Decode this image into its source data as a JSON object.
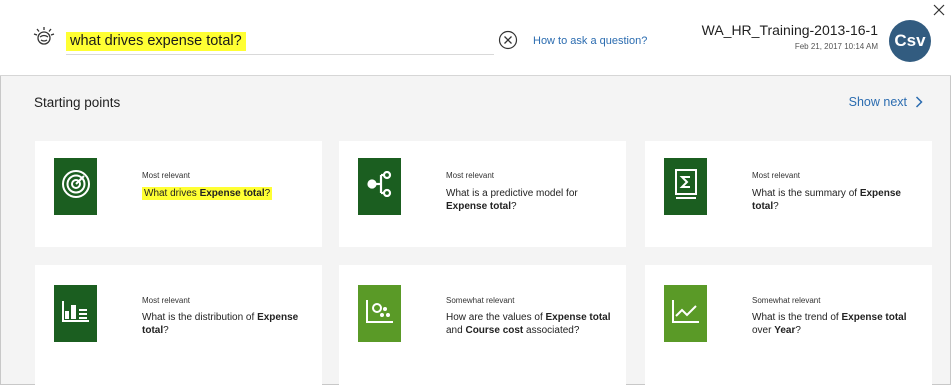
{
  "header": {
    "search_query": "what drives expense total?",
    "help_link": "How to ask a question?",
    "dataset_name": "WA_HR_Training-2013-16-1",
    "dataset_date": "Feb 21, 2017 10:14 AM",
    "avatar_text": "Csv"
  },
  "section": {
    "title": "Starting points",
    "show_next": "Show next"
  },
  "cards": [
    {
      "relevance": "Most relevant",
      "question_parts": [
        {
          "text": "What drives ",
          "bold": false
        },
        {
          "text": "Expense total",
          "bold": true
        },
        {
          "text": "?",
          "bold": false
        }
      ],
      "icon": "target-radar-icon",
      "color": "#1b5e20",
      "highlighted": true
    },
    {
      "relevance": "Most relevant",
      "question_parts": [
        {
          "text": "What is a predictive model for ",
          "bold": false
        },
        {
          "text": "Expense total",
          "bold": true
        },
        {
          "text": "?",
          "bold": false
        }
      ],
      "icon": "decision-tree-icon",
      "color": "#1b5e20",
      "highlighted": false
    },
    {
      "relevance": "Most relevant",
      "question_parts": [
        {
          "text": "What is the summary of ",
          "bold": false
        },
        {
          "text": "Expense total",
          "bold": true
        },
        {
          "text": "?",
          "bold": false
        }
      ],
      "icon": "sigma-summary-icon",
      "color": "#1b5e20",
      "highlighted": false
    },
    {
      "relevance": "Most relevant",
      "question_parts": [
        {
          "text": "What is the distribution of ",
          "bold": false
        },
        {
          "text": "Expense total",
          "bold": true
        },
        {
          "text": "?",
          "bold": false
        }
      ],
      "icon": "distribution-chart-icon",
      "color": "#1b5e20",
      "highlighted": false
    },
    {
      "relevance": "Somewhat relevant",
      "question_parts": [
        {
          "text": "How are the values of ",
          "bold": false
        },
        {
          "text": "Expense total",
          "bold": true
        },
        {
          "text": " and ",
          "bold": false
        },
        {
          "text": "Course cost",
          "bold": true
        },
        {
          "text": " associated?",
          "bold": false
        }
      ],
      "icon": "scatter-association-icon",
      "color": "#5a9a27",
      "highlighted": false
    },
    {
      "relevance": "Somewhat relevant",
      "question_parts": [
        {
          "text": "What is the trend of ",
          "bold": false
        },
        {
          "text": "Expense total",
          "bold": true
        },
        {
          "text": " over ",
          "bold": false
        },
        {
          "text": "Year",
          "bold": true
        },
        {
          "text": "?",
          "bold": false
        }
      ],
      "icon": "trend-line-icon",
      "color": "#5a9a27",
      "highlighted": false
    }
  ]
}
